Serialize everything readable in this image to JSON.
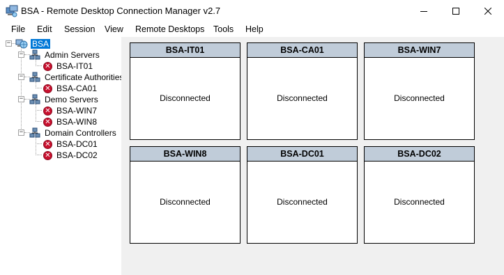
{
  "window": {
    "title": "BSA - Remote Desktop Connection Manager v2.7",
    "icon": "rdcman-app-icon",
    "controls": [
      "minimize-icon",
      "maximize-icon",
      "close-icon"
    ]
  },
  "menu": [
    "File",
    "Edit",
    "Session",
    "View",
    "Remote Desktops",
    "Tools",
    "Help"
  ],
  "tree": {
    "root": {
      "label": "BSA",
      "icon": "network-group-icon",
      "expanded": true,
      "selected": true
    },
    "groups": [
      {
        "label": "Admin Servers",
        "icon": "server-group-icon",
        "servers": [
          {
            "label": "BSA-IT01",
            "icon": "disconnected-icon"
          }
        ]
      },
      {
        "label": "Certificate Authorities",
        "icon": "server-group-icon",
        "servers": [
          {
            "label": "BSA-CA01",
            "icon": "disconnected-icon"
          }
        ]
      },
      {
        "label": "Demo Servers",
        "icon": "server-group-icon",
        "servers": [
          {
            "label": "BSA-WIN7",
            "icon": "disconnected-icon"
          },
          {
            "label": "BSA-WIN8",
            "icon": "disconnected-icon"
          }
        ]
      },
      {
        "label": "Domain Controllers",
        "icon": "server-group-icon",
        "servers": [
          {
            "label": "BSA-DC01",
            "icon": "disconnected-icon"
          },
          {
            "label": "BSA-DC02",
            "icon": "disconnected-icon"
          }
        ]
      }
    ]
  },
  "thumbnails": [
    {
      "name": "BSA-IT01",
      "status": "Disconnected"
    },
    {
      "name": "BSA-CA01",
      "status": "Disconnected"
    },
    {
      "name": "BSA-WIN7",
      "status": "Disconnected"
    },
    {
      "name": "BSA-WIN8",
      "status": "Disconnected"
    },
    {
      "name": "BSA-DC01",
      "status": "Disconnected"
    },
    {
      "name": "BSA-DC02",
      "status": "Disconnected"
    }
  ],
  "colors": {
    "thumbnail_header": "#c0ccd9",
    "selection": "#0078d7",
    "disconnected": "#c8102e",
    "client_background": "#f0f0f0"
  }
}
